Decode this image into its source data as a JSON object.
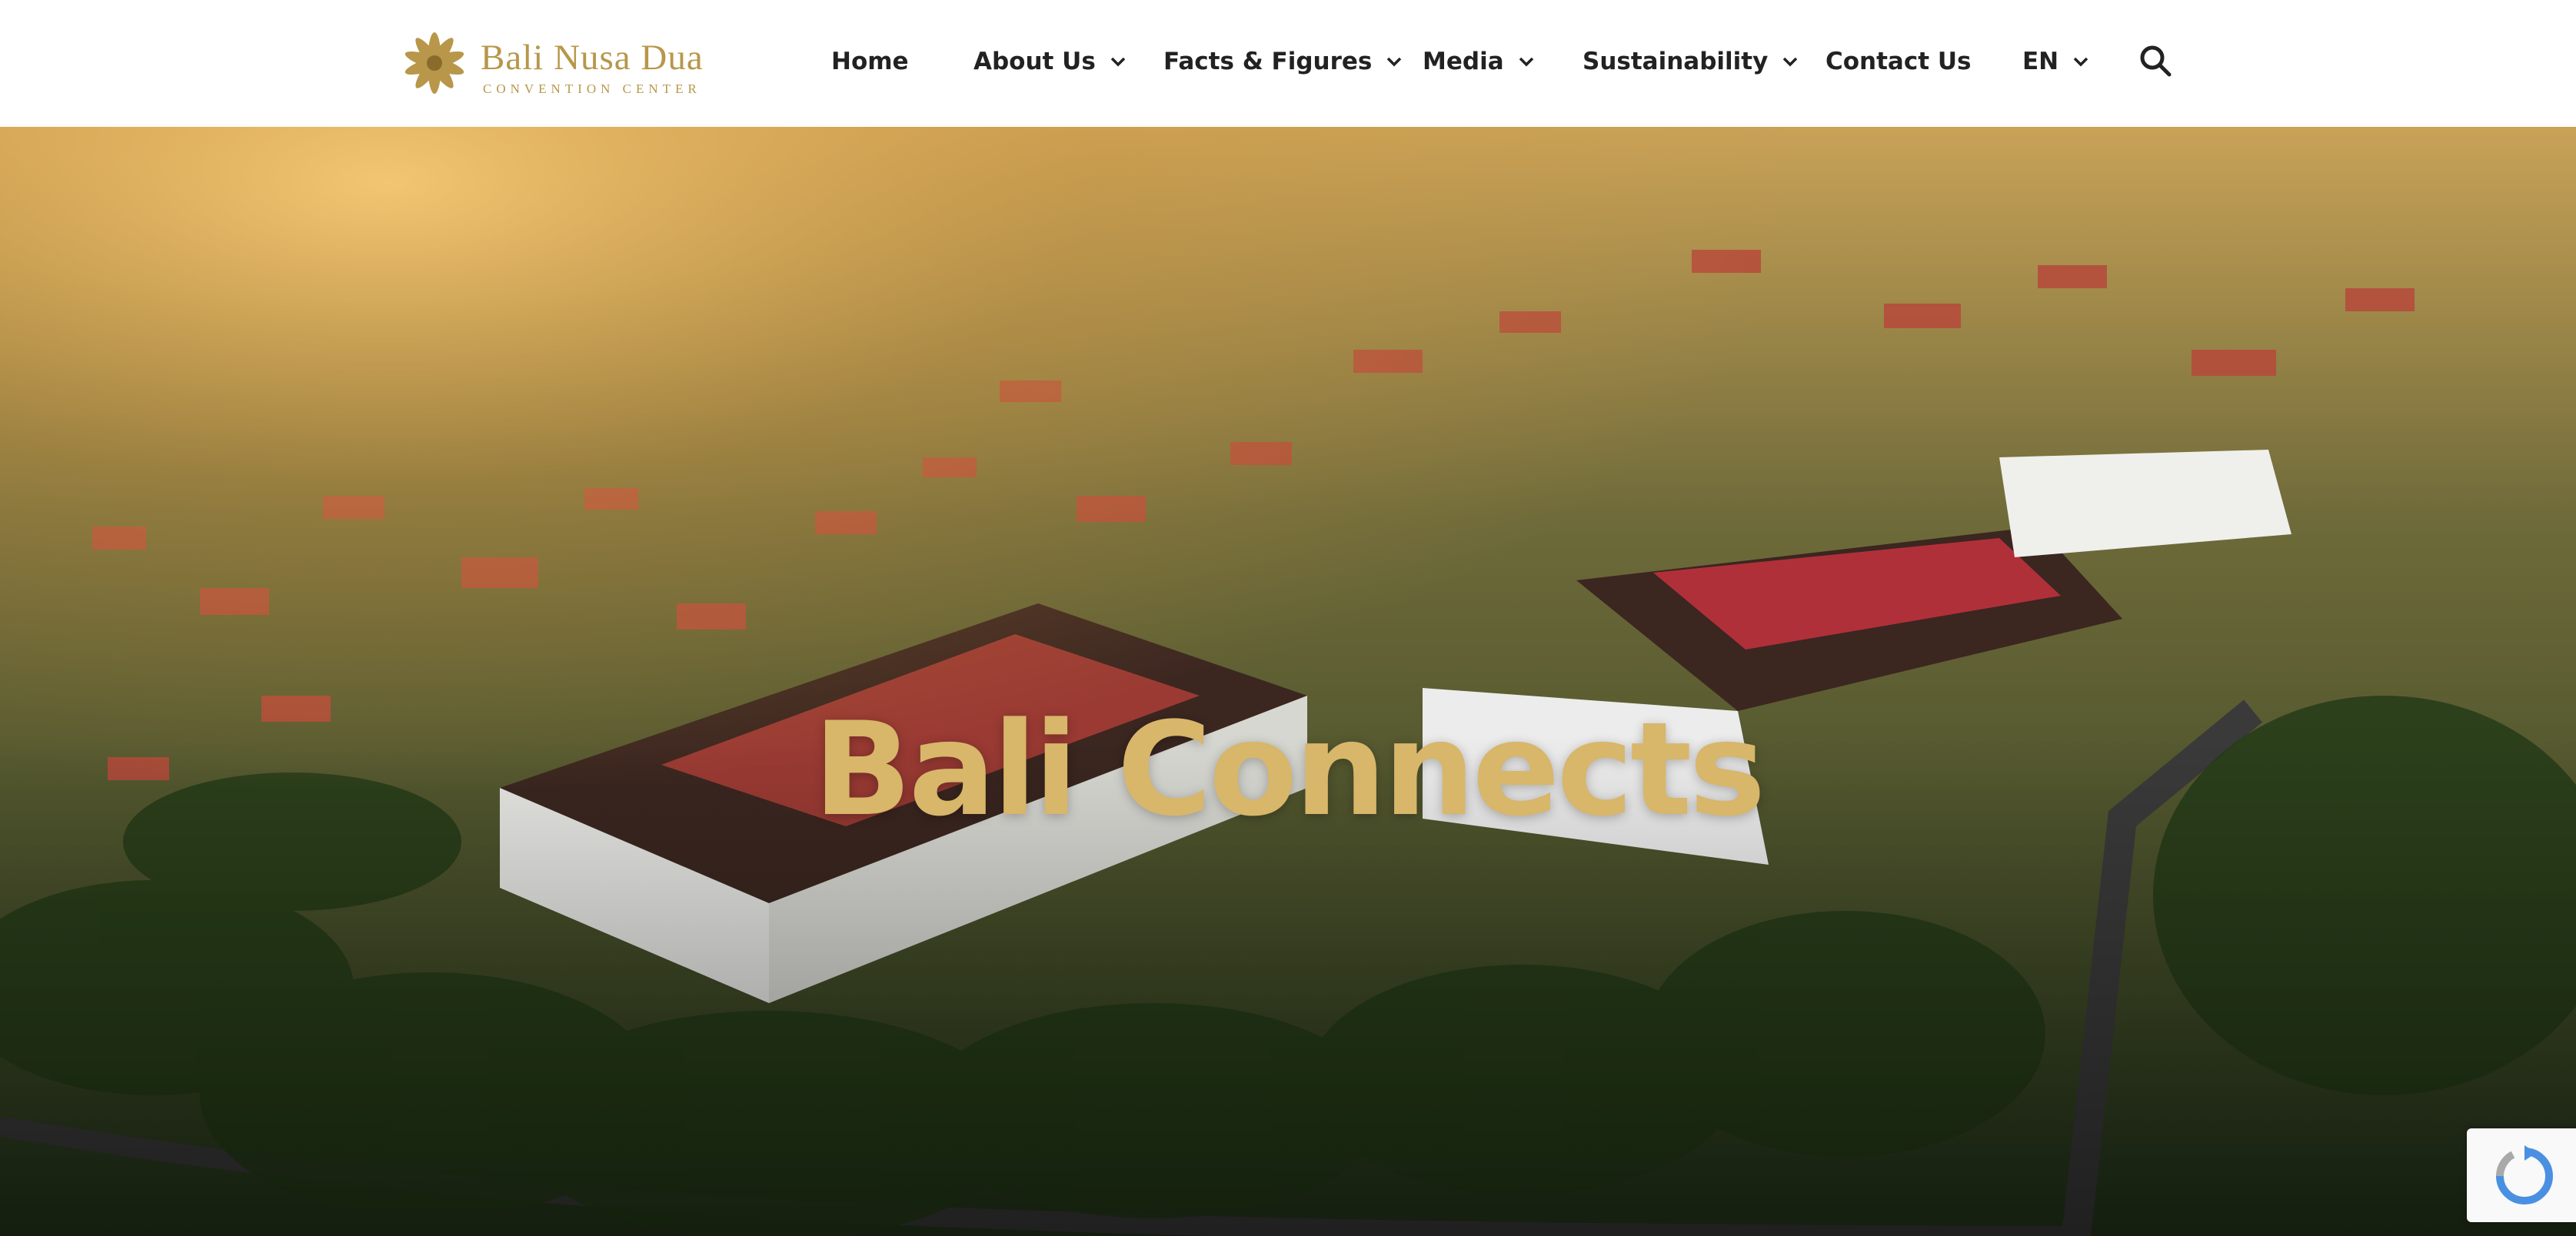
{
  "header": {
    "logo": {
      "name": "Bali Nusa Dua",
      "subtitle": "CONVENTION CENTER",
      "brand_color": "#b8974a"
    },
    "nav": [
      {
        "label": "Home",
        "has_dropdown": false
      },
      {
        "label": "About Us",
        "has_dropdown": true
      },
      {
        "label": "Facts & Figures",
        "has_dropdown": true
      },
      {
        "label": "Media",
        "has_dropdown": true
      },
      {
        "label": "Sustainability",
        "has_dropdown": true
      },
      {
        "label": "Contact Us",
        "has_dropdown": false
      },
      {
        "label": "EN",
        "has_dropdown": true
      }
    ],
    "search_icon": "search-icon"
  },
  "hero": {
    "title": "Bali Connects",
    "title_color": "#d8b66a",
    "background": "aerial photo of convention center with red roofs and tropical trees"
  },
  "recaptcha": {
    "icon": "recaptcha-icon"
  }
}
